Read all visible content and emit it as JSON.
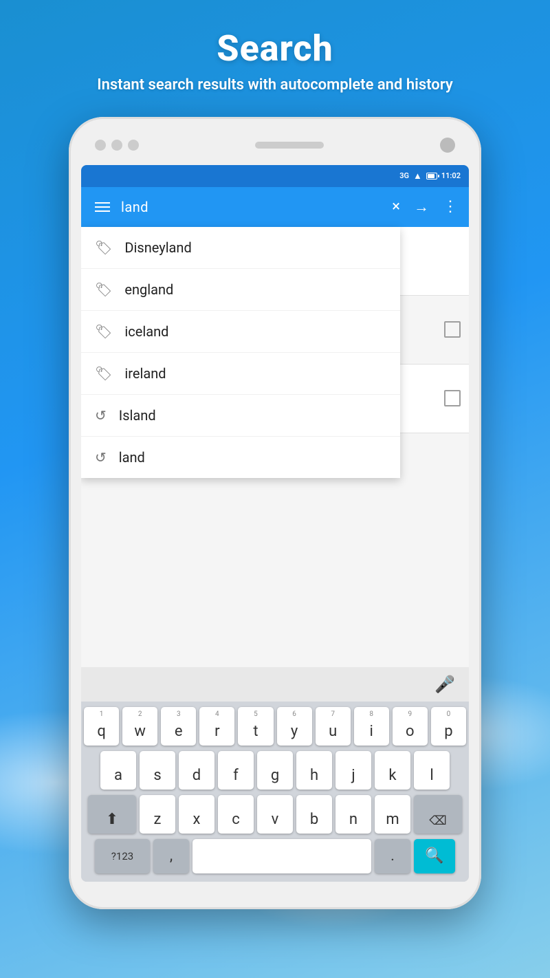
{
  "header": {
    "title": "Search",
    "subtitle": "Instant search results with autocomplete\nand history"
  },
  "status_bar": {
    "network": "3G",
    "time": "11:02"
  },
  "app_bar": {
    "search_query": "land",
    "clear_label": "×",
    "go_label": "→"
  },
  "autocomplete": {
    "items": [
      {
        "type": "folder",
        "label": "Disneyland"
      },
      {
        "type": "folder",
        "label": "england"
      },
      {
        "type": "folder",
        "label": "iceland"
      },
      {
        "type": "folder",
        "label": "ireland"
      },
      {
        "type": "history",
        "label": "Island"
      },
      {
        "type": "history",
        "label": "land"
      }
    ]
  },
  "keyboard": {
    "rows": [
      [
        "q",
        "w",
        "e",
        "r",
        "t",
        "y",
        "u",
        "i",
        "o",
        "p"
      ],
      [
        "a",
        "s",
        "d",
        "f",
        "g",
        "h",
        "j",
        "k",
        "l"
      ],
      [
        "z",
        "x",
        "c",
        "v",
        "b",
        "n",
        "m"
      ]
    ],
    "numbers": [
      "1",
      "2",
      "3",
      "4",
      "5",
      "6",
      "7",
      "8",
      "9",
      "0"
    ],
    "special_keys": {
      "numeric": "?123",
      "comma": ",",
      "period": ".",
      "search_icon": "🔍"
    }
  },
  "colors": {
    "primary": "#2196f3",
    "primary_dark": "#1976d2",
    "search_btn": "#00bcd4",
    "text_dark": "#212121",
    "text_grey": "#757575"
  }
}
